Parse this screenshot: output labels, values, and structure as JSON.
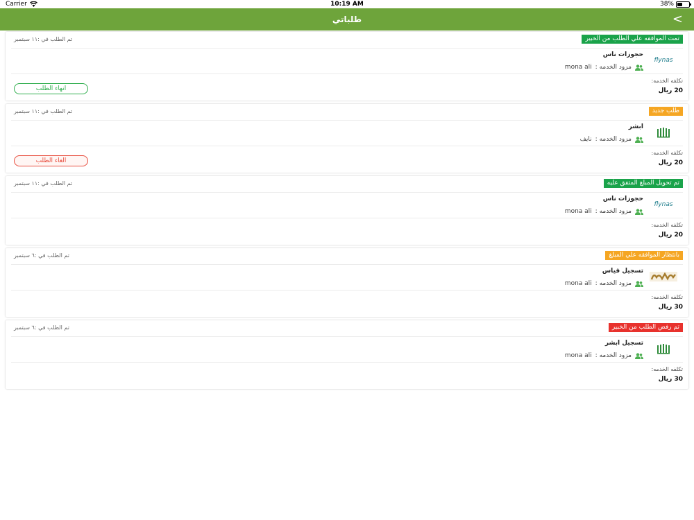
{
  "status_bar": {
    "carrier": "Carrier",
    "time": "10:19 AM",
    "battery": "38%",
    "battery_level": 0.38
  },
  "nav": {
    "title": "طلباتي",
    "back": "<"
  },
  "orders": [
    {
      "status": "تمت الموافقه علي الطلب من الخبير",
      "status_color": "#1aa34a",
      "date": "تم الطلب في :١١ سبتمبر",
      "logo": "flynas",
      "logo_text": "flynas",
      "service": "حجوزات ناس",
      "provider_label": "مزود الخدمه :",
      "provider": "mona  ali",
      "cost_label": "تكلفه الخدمه:",
      "cost": "20 ريال",
      "action": "انهاء الطلب",
      "action_type": "green"
    },
    {
      "status": "طلب جديد",
      "status_color": "#f5a623",
      "date": "تم الطلب في :١١ سبتمبر",
      "logo": "absher",
      "service": "ابشر",
      "provider_label": "مزود الخدمه :",
      "provider": "نايف",
      "cost_label": "تكلفه الخدمه:",
      "cost": "20 ريال",
      "action": "الغاء الطلب",
      "action_type": "red"
    },
    {
      "status": "تم تحويل المبلغ المتفق عليه",
      "status_color": "#1aa34a",
      "date": "تم الطلب في :١١ سبتمبر",
      "logo": "flynas",
      "logo_text": "flynas",
      "service": "حجوزات ناس",
      "provider_label": "مزود الخدمه :",
      "provider": "mona  ali",
      "cost_label": "تكلفه الخدمه:",
      "cost": "20 ريال",
      "action": "",
      "action_type": ""
    },
    {
      "status": "بانتظار الموافقه علي المبلغ",
      "status_color": "#f5a623",
      "date": "تم الطلب في :٦ سبتمبر",
      "logo": "qiyas",
      "service": "تسجيل قياس",
      "provider_label": "مزود الخدمه :",
      "provider": "mona  ali",
      "cost_label": "تكلفه الخدمه:",
      "cost": "30 ريال",
      "action": "",
      "action_type": ""
    },
    {
      "status": "تم رفض الطلب من الخبير",
      "status_color": "#e8322d",
      "date": "تم الطلب في :٦ سبتمبر",
      "logo": "absher",
      "service": "تسجيل ابشر",
      "provider_label": "مزود الخدمه :",
      "provider": "mona  ali",
      "cost_label": "تكلفه الخدمه:",
      "cost": "30 ريال",
      "action": "",
      "action_type": ""
    }
  ],
  "colors": {
    "nav": "#6ea43b",
    "provider_icon": "#4caf50"
  }
}
